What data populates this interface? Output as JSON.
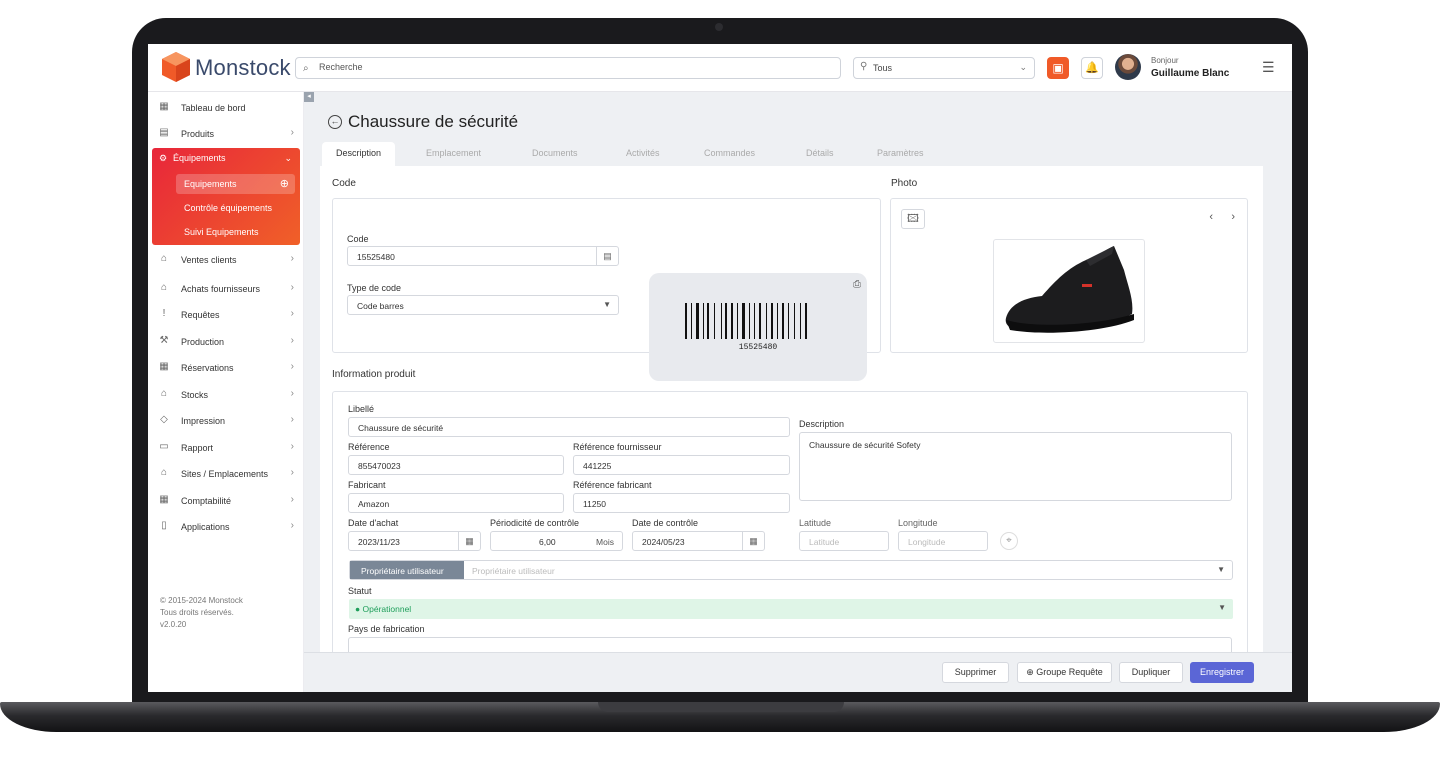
{
  "app": {
    "brand": "Monstock"
  },
  "header": {
    "search_placeholder": "Recherche",
    "location_value": "Tous",
    "greeting": "Bonjour",
    "user_name": "Guillaume Blanc"
  },
  "sidebar": {
    "items_top": [
      {
        "label": "Tableau de bord",
        "icon": "dashboard-icon"
      },
      {
        "label": "Produits",
        "icon": "box-icon"
      }
    ],
    "equipments": {
      "label": "Équipements",
      "sub": [
        "Equipements",
        "Contrôle équipements",
        "Suivi Equipements"
      ]
    },
    "items_bottom": [
      {
        "label": "Ventes clients",
        "icon": "store-icon"
      },
      {
        "label": "Achats fournisseurs",
        "icon": "supplier-icon"
      },
      {
        "label": "Requêtes",
        "icon": "request-icon"
      },
      {
        "label": "Production",
        "icon": "production-icon"
      },
      {
        "label": "Réservations",
        "icon": "calendar-icon"
      },
      {
        "label": "Stocks",
        "icon": "warehouse-icon"
      },
      {
        "label": "Impression",
        "icon": "tag-icon"
      },
      {
        "label": "Rapport",
        "icon": "report-icon"
      },
      {
        "label": "Sites / Emplacements",
        "icon": "sites-icon"
      },
      {
        "label": "Comptabilité",
        "icon": "accounting-icon"
      },
      {
        "label": "Applications",
        "icon": "apps-icon"
      }
    ],
    "copyright": [
      "© 2015-2024 Monstock",
      "Tous droits réservés.",
      "v2.0.20"
    ]
  },
  "page": {
    "title": "Chaussure de sécurité",
    "tabs": [
      "Description",
      "Emplacement",
      "Documents",
      "Activités",
      "Commandes",
      "Détails",
      "Paramètres"
    ],
    "active_tab": "Description"
  },
  "code_section": {
    "title": "Code",
    "code_label": "Code",
    "code_value": "15525480",
    "type_label": "Type de code",
    "type_value": "Code barres",
    "barcode_number": "15525480"
  },
  "photo_section": {
    "title": "Photo"
  },
  "info": {
    "title": "Information produit",
    "libelle_label": "Libellé",
    "libelle": "Chaussure de sécurité",
    "reference_label": "Référence",
    "reference": "855470023",
    "ref_fournisseur_label": "Référence fournisseur",
    "ref_fournisseur": "441225",
    "fabricant_label": "Fabricant",
    "fabricant": "Amazon",
    "ref_fabricant_label": "Référence fabricant",
    "ref_fabricant": "11250",
    "description_label": "Description",
    "description": "Chaussure de sécurité Sofety",
    "date_achat_label": "Date d'achat",
    "date_achat": "2023/11/23",
    "periodicite_label": "Périodicité de contrôle",
    "periodicite": "6,00",
    "periodicite_unit": "Mois",
    "date_controle_label": "Date de contrôle",
    "date_controle": "2024/05/23",
    "latitude_label": "Latitude",
    "latitude_placeholder": "Latitude",
    "longitude_label": "Longitude",
    "longitude_placeholder": "Longitude",
    "owner_prefix": "Propriétaire utilisateur",
    "owner_placeholder": "Propriétaire utilisateur",
    "statut_label": "Statut",
    "statut": "Opérationnel",
    "pays_label": "Pays de fabrication"
  },
  "footer": {
    "delete": "Supprimer",
    "group_request": "Groupe Requête",
    "duplicate": "Dupliquer",
    "save": "Enregistrer"
  },
  "colors": {
    "accent": "#f05a28",
    "primary_button": "#5b66d6",
    "status_green": "#1e9e5a"
  }
}
